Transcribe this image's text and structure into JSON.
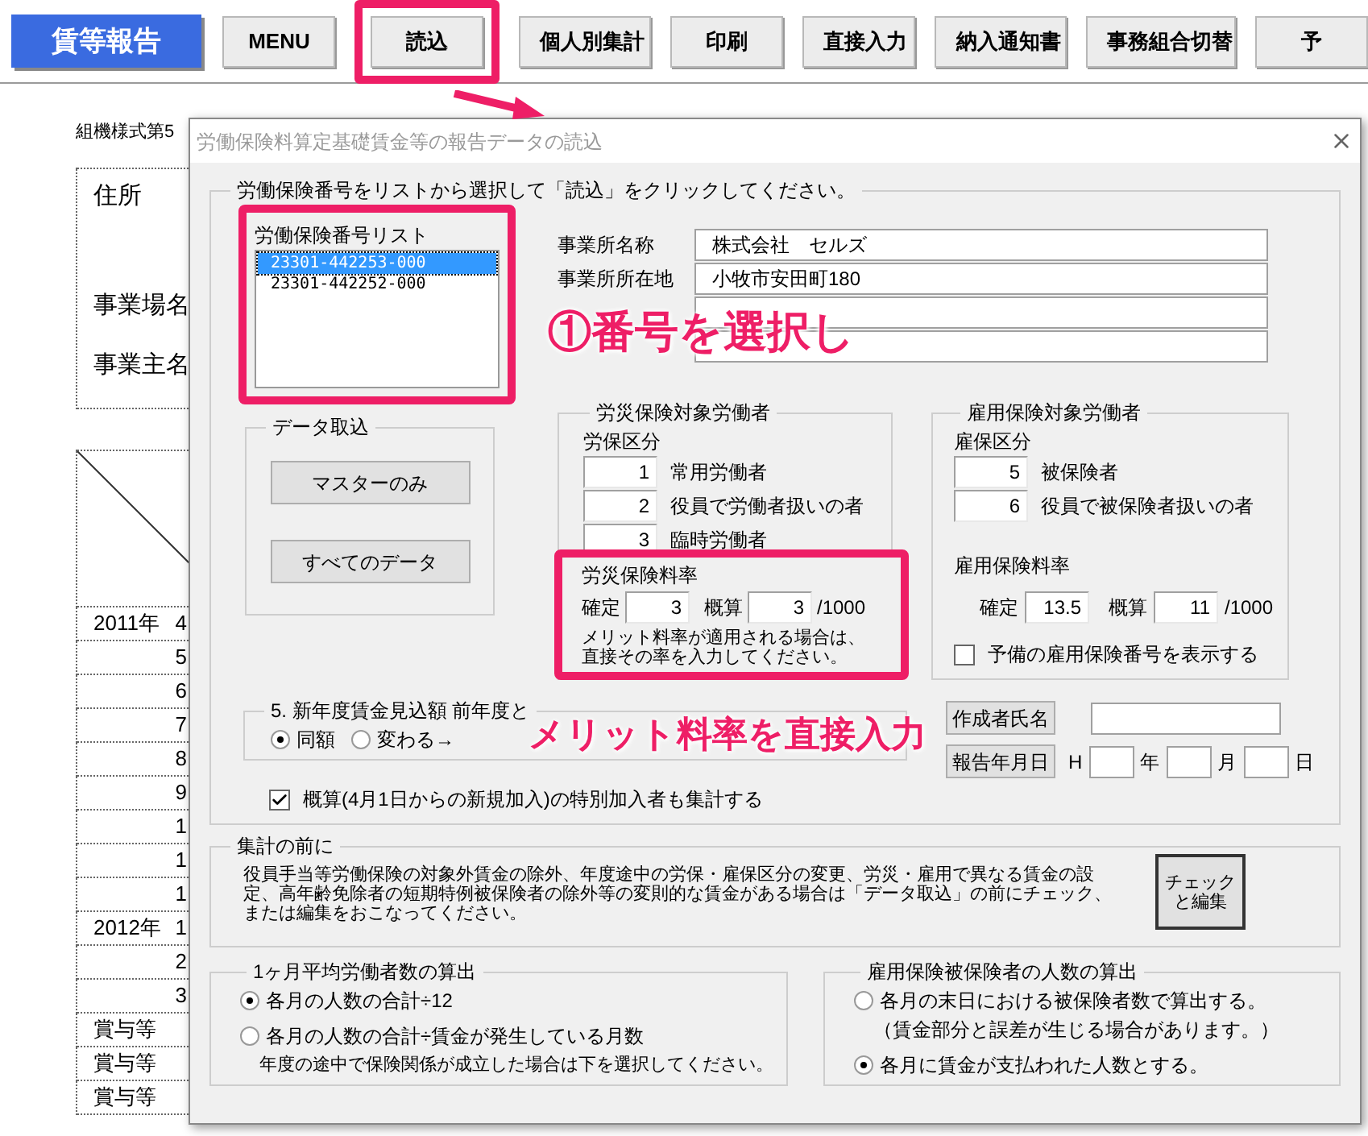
{
  "toolbar": {
    "title": "賃等報告",
    "buttons": [
      {
        "label": "MENU",
        "highlighted": false
      },
      {
        "label": "読込",
        "highlighted": true
      },
      {
        "label": "個人別集計",
        "highlighted": false
      },
      {
        "label": "印刷",
        "highlighted": false
      },
      {
        "label": "直接入力",
        "highlighted": false
      },
      {
        "label": "納入通知書",
        "highlighted": false
      },
      {
        "label": "事務組合切替",
        "highlighted": false
      },
      {
        "label": "予",
        "highlighted": false
      }
    ]
  },
  "sheet": {
    "form_code": "組機様式第5",
    "labels": [
      "住所",
      "事業場名",
      "事業主名"
    ],
    "rows": [
      {
        "year": "2011年",
        "month": "4"
      },
      {
        "year": "",
        "month": "5"
      },
      {
        "year": "",
        "month": "6"
      },
      {
        "year": "",
        "month": "7"
      },
      {
        "year": "",
        "month": "8"
      },
      {
        "year": "",
        "month": "9"
      },
      {
        "year": "",
        "month": "1"
      },
      {
        "year": "",
        "month": "1"
      },
      {
        "year": "",
        "month": "1"
      },
      {
        "year": "2012年",
        "month": "1"
      },
      {
        "year": "",
        "month": "2"
      },
      {
        "year": "",
        "month": "3"
      },
      {
        "year": "賞与等",
        "month": ""
      },
      {
        "year": "賞与等",
        "month": ""
      },
      {
        "year": "賞与等",
        "month": ""
      }
    ]
  },
  "dialog": {
    "title": "労働保険料算定基礎賃金等の報告データの読込",
    "instruction": "労働保険番号をリストから選択して「読込」をクリックしてください。",
    "number_list": {
      "label": "労働保険番号リスト",
      "highlighted": true,
      "items": [
        {
          "text": "23301-442253-000",
          "selected": true
        },
        {
          "text": "23301-442252-000",
          "selected": false
        }
      ]
    },
    "data_import": {
      "title": "データ取込",
      "buttons": [
        "マスターのみ",
        "すべてのデータ"
      ]
    },
    "office_fields": [
      {
        "label": "事業所名称",
        "value": "株式会社　セルズ"
      },
      {
        "label": "事業所所在地",
        "value": "小牧市安田町180"
      }
    ],
    "rosai": {
      "title": "労災保険対象労働者",
      "class_label": "労保区分",
      "classes": [
        {
          "code": "1",
          "name": "常用労働者"
        },
        {
          "code": "2",
          "name": "役員で労働者扱いの者"
        },
        {
          "code": "3",
          "name": "臨時労働者"
        }
      ],
      "rate_title": "労災保険料率",
      "rate_highlighted": true,
      "fixed_label": "確定",
      "fixed": "3",
      "estimate_label": "概算",
      "estimate": "3",
      "unit": "/1000",
      "note": "メリット料率が適用される場合は、直接その率を入力してください。"
    },
    "koyo": {
      "title": "雇用保険対象労働者",
      "class_label": "雇保区分",
      "classes": [
        {
          "code": "5",
          "name": "被保険者"
        },
        {
          "code": "6",
          "name": "役員で被保険者扱いの者"
        }
      ],
      "rate_title": "雇用保険料率",
      "fixed_label": "確定",
      "fixed": "13.5",
      "estimate_label": "概算",
      "estimate": "11",
      "unit": "/1000",
      "spare_checkbox": {
        "label": "予備の雇用保険番号を表示する",
        "checked": false
      }
    },
    "new_year": {
      "title": "5. 新年度賃金見込額 前年度と",
      "options": [
        {
          "label": "同額",
          "selected": true
        },
        {
          "label": "変わる→",
          "selected": false
        }
      ]
    },
    "author_button": "作成者氏名",
    "report_date": {
      "button": "報告年月日",
      "era": "H",
      "units": [
        "年",
        "月",
        "日"
      ]
    },
    "special_checkbox": {
      "label": "概算(4月1日からの新規加入)の特別加入者も集計する",
      "checked": true
    },
    "before_total": {
      "title": "集計の前に",
      "text": "役員手当等労働保険の対象外賃金の除外、年度途中の労保・雇保区分の変更、労災・雇用で異なる賃金の設定、高年齢免除者の短期特例被保険者の除外等の変則的な賃金がある場合は「データ取込」の前にチェック、または編集をおこなってください。",
      "button": "チェックと編集"
    },
    "avg_workers": {
      "title": "1ヶ月平均労働者数の算出",
      "options": [
        {
          "label": "各月の人数の合計÷12",
          "selected": true
        },
        {
          "label": "各月の人数の合計÷賃金が発生している月数",
          "selected": false
        }
      ],
      "note": "年度の途中で保険関係が成立した場合は下を選択してください。"
    },
    "insured_count": {
      "title": "雇用保険被保険者の人数の算出",
      "options": [
        {
          "label": "各月の末日における被保険者数で算出する。",
          "note": "（賃金部分と誤差が生じる場合があります。）",
          "selected": false
        },
        {
          "label": "各月に賃金が支払われた人数とする。",
          "selected": true
        }
      ]
    }
  },
  "annotations": [
    "①番号を選択し",
    "メリット料率を直接入力"
  ]
}
